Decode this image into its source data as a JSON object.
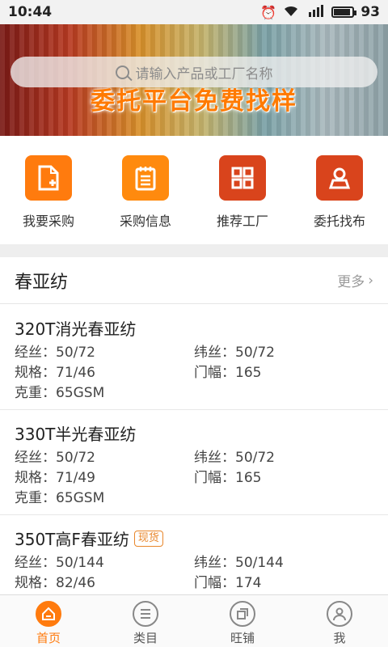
{
  "status_bar": {
    "time": "10:44",
    "battery": "93",
    "battery_fraction": 0.93,
    "network": "4G",
    "icons": [
      "alarm-icon",
      "wifi-icon",
      "signal-icon",
      "battery-icon"
    ]
  },
  "banner": {
    "search_placeholder": "请输入产品或工厂名称",
    "slogan": "委托平台免费找样",
    "slide_count": 2,
    "active_slide": 1
  },
  "quick_nav": [
    {
      "label": "我要采购",
      "icon": "document-add-icon",
      "color": "#ff7b0e"
    },
    {
      "label": "采购信息",
      "icon": "notepad-icon",
      "color": "#ff8a0e"
    },
    {
      "label": "推荐工厂",
      "icon": "grid-icon",
      "color": "#d9441c"
    },
    {
      "label": "委托找布",
      "icon": "person-icon",
      "color": "#d9441c"
    }
  ],
  "section": {
    "title": "春亚纺",
    "more": "更多"
  },
  "products": [
    {
      "name": "320T消光春亚纺",
      "tag": "",
      "specs": [
        "经丝：50/72",
        "纬丝：50/72",
        "规格：71/46",
        "门幅：165",
        "克重：65GSM"
      ]
    },
    {
      "name": "330T半光春亚纺",
      "tag": "",
      "specs": [
        "经丝：50/72",
        "纬丝：50/72",
        "规格：71/49",
        "门幅：165",
        "克重：65GSM"
      ]
    },
    {
      "name": "350T高F春亚纺",
      "tag": "现货",
      "specs": [
        "经丝：50/144",
        "纬丝：50/144",
        "规格：82/46",
        "门幅：174"
      ]
    }
  ],
  "tab_bar": [
    {
      "label": "首页",
      "icon": "home-icon",
      "active": true
    },
    {
      "label": "类目",
      "icon": "category-list-icon",
      "active": false
    },
    {
      "label": "旺铺",
      "icon": "shop-icon",
      "active": false
    },
    {
      "label": "我",
      "icon": "profile-icon",
      "active": false
    }
  ],
  "colors": {
    "accent": "#ff7b0e",
    "accent_dark": "#d9441c",
    "tag": "#e8862a"
  }
}
